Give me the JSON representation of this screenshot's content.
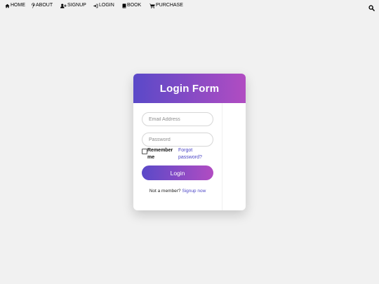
{
  "nav": {
    "items": [
      {
        "label": "HOME",
        "icon": "home-icon"
      },
      {
        "label": "ABOUT",
        "icon": "pinterest-icon"
      },
      {
        "label": "SIGNUP",
        "icon": "user-plus-icon"
      },
      {
        "label": "LOGIN",
        "icon": "sign-in-icon"
      },
      {
        "label": "BOOK",
        "icon": "book-icon"
      },
      {
        "label": "PURCHASE",
        "icon": "cart-icon"
      }
    ],
    "search_icon": "search-icon"
  },
  "form": {
    "title": "Login Form",
    "email_placeholder": "Email Address",
    "password_placeholder": "Password",
    "remember_label": "Remember me",
    "forgot_label": "Forgot password?",
    "login_label": "Login",
    "signup_prompt": "Not a member?",
    "signup_link": "Signup now"
  },
  "colors": {
    "gradient_start": "#5a49c8",
    "gradient_end": "#b14cc2",
    "link": "#4b45c6",
    "background": "#f1f1f1"
  }
}
